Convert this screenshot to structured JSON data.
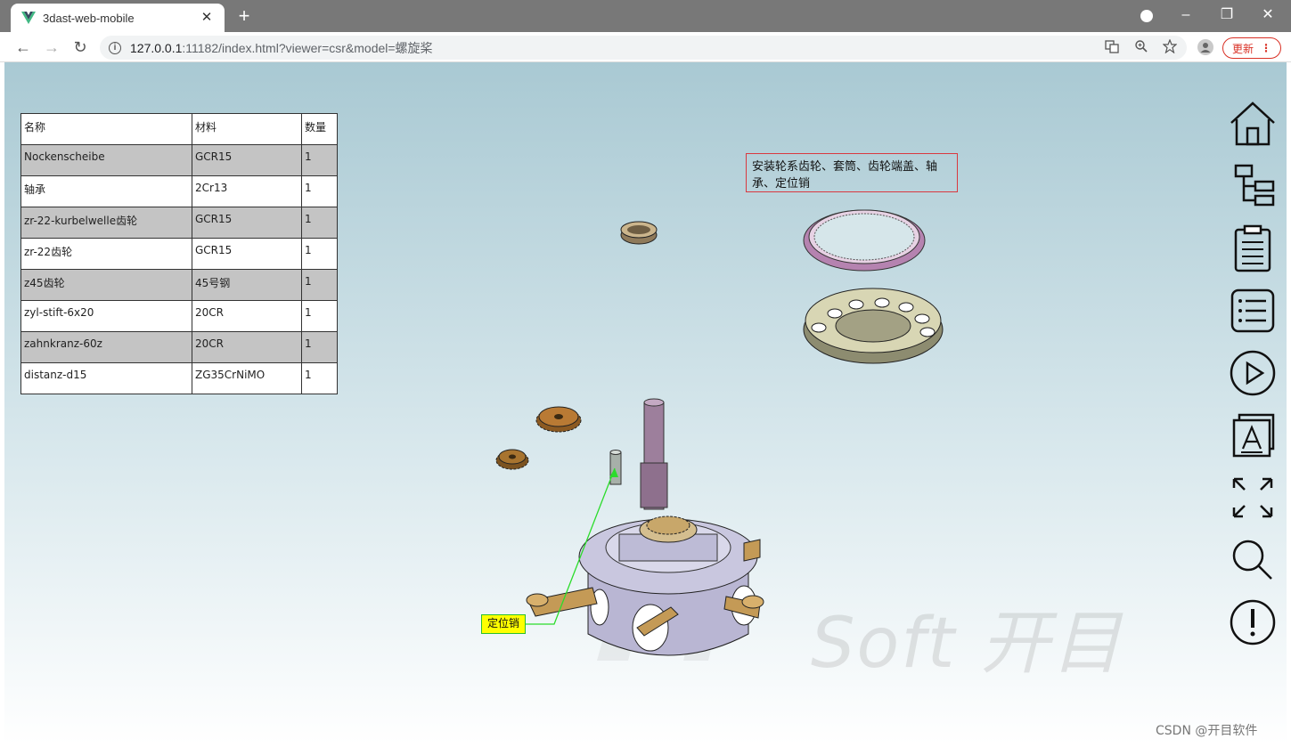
{
  "browser": {
    "tab_title": "3dast-web-mobile",
    "tab_close": "✕",
    "new_tab": "+",
    "url_host": "127.0.0.1",
    "url_rest": ":11182/index.html?viewer=csr&model=螺旋桨",
    "update_label": "更新",
    "back": "←",
    "forward": "→",
    "reload": "↻",
    "minimize": "–",
    "restore": "❐",
    "close": "✕",
    "menu": "⋮",
    "accent": "#d93025"
  },
  "bom": {
    "headers": [
      "名称",
      "材料",
      "数量"
    ],
    "rows": [
      [
        "Nockenscheibe",
        "GCR15",
        "1"
      ],
      [
        "轴承",
        "2Cr13",
        "1"
      ],
      [
        "zr-22-kurbelwelle齿轮",
        "GCR15",
        "1"
      ],
      [
        "zr-22齿轮",
        "GCR15",
        "1"
      ],
      [
        "z45齿轮",
        "45号钢",
        "1"
      ],
      [
        "zyl-stift-6x20",
        "20CR",
        "1"
      ],
      [
        "zahnkranz-60z",
        "20CR",
        "1"
      ],
      [
        "distanz-d15",
        "ZG35CrNiMO",
        "1"
      ]
    ]
  },
  "viewer": {
    "step_note": "安装轮系齿轮、套筒、齿轮端盖、轴承、定位销",
    "callout_label": "定位销",
    "watermark": "Soft 开目",
    "credit": "CSDN @开目软件"
  },
  "side_tools": [
    "home-icon",
    "tree-icon",
    "clipboard-icon",
    "list-icon",
    "play-icon",
    "annotation-icon",
    "fit-view-icon",
    "search-icon",
    "info-icon"
  ]
}
